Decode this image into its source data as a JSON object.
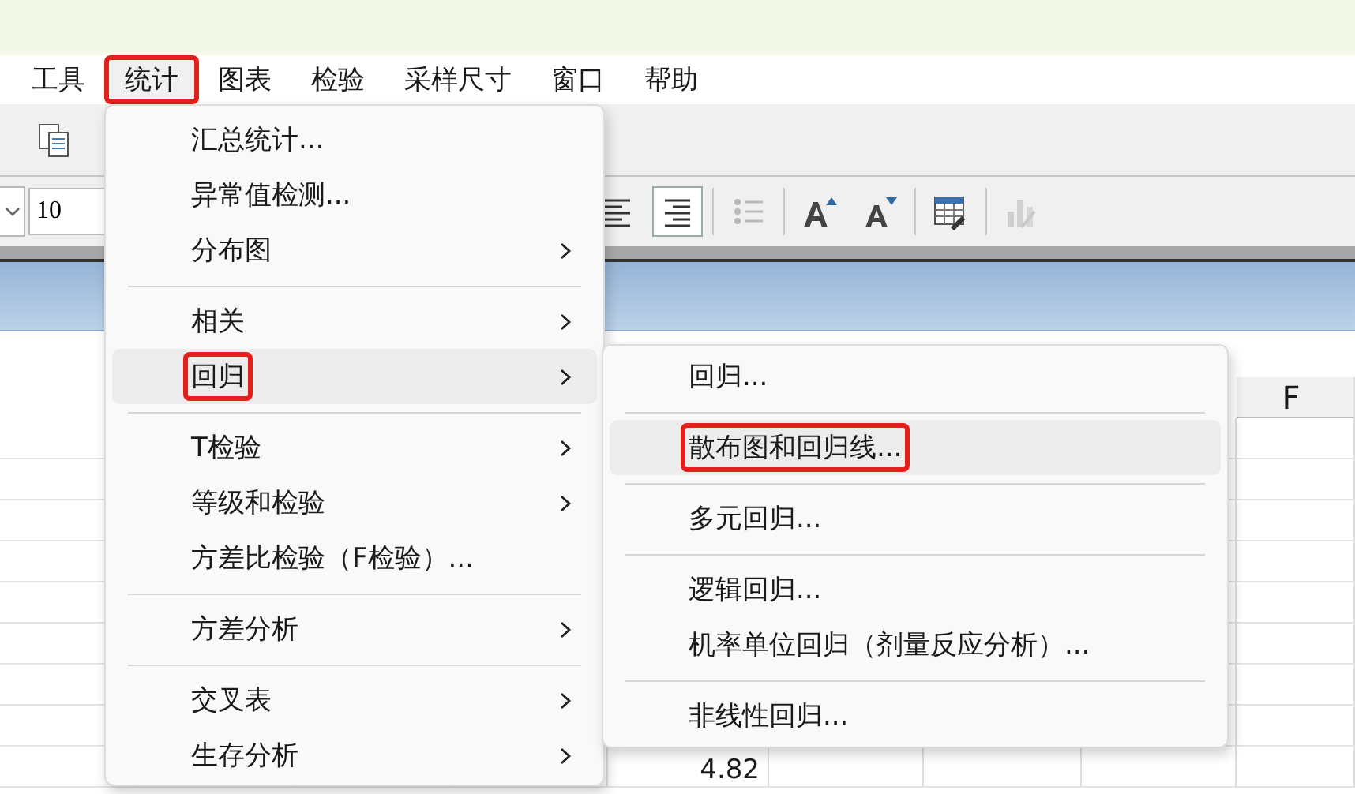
{
  "menubar": [
    {
      "label": "工具",
      "selected": false,
      "annotated": false
    },
    {
      "label": "统计",
      "selected": true,
      "annotated": true
    },
    {
      "label": "图表",
      "selected": false,
      "annotated": false
    },
    {
      "label": "检验",
      "selected": false,
      "annotated": false
    },
    {
      "label": "采样尺寸",
      "selected": false,
      "annotated": false
    },
    {
      "label": "窗口",
      "selected": false,
      "annotated": false
    },
    {
      "label": "帮助",
      "selected": false,
      "annotated": false
    }
  ],
  "toolbar": {
    "buttons": [
      {
        "kind": "copy",
        "disabled": false
      }
    ]
  },
  "format_bar": {
    "font_size": "10",
    "buttons": [
      {
        "kind": "align-left",
        "pressed": false,
        "disabled": false
      },
      {
        "kind": "align-right",
        "pressed": true,
        "disabled": false
      },
      {
        "kind": "bullet-list",
        "pressed": false,
        "disabled": true
      },
      {
        "kind": "font-grow",
        "pressed": false,
        "disabled": false
      },
      {
        "kind": "font-shrink",
        "pressed": false,
        "disabled": false
      },
      {
        "kind": "table-settings",
        "pressed": false,
        "disabled": false
      },
      {
        "kind": "chart-edit",
        "pressed": false,
        "disabled": true
      }
    ]
  },
  "sheet": {
    "column_header": "F",
    "cell": "4.82"
  },
  "menu": {
    "items": [
      {
        "kind": "item",
        "label": "汇总统计...",
        "submenu": false,
        "selected": false,
        "annotated": false
      },
      {
        "kind": "item",
        "label": "异常值检测...",
        "submenu": false,
        "selected": false,
        "annotated": false
      },
      {
        "kind": "item",
        "label": "分布图",
        "submenu": true,
        "selected": false,
        "annotated": false
      },
      {
        "kind": "separator"
      },
      {
        "kind": "item",
        "label": "相关",
        "submenu": true,
        "selected": false,
        "annotated": false
      },
      {
        "kind": "item",
        "label": "回归",
        "submenu": true,
        "selected": true,
        "annotated": true
      },
      {
        "kind": "separator"
      },
      {
        "kind": "item",
        "label": "T检验",
        "submenu": true,
        "selected": false,
        "annotated": false
      },
      {
        "kind": "item",
        "label": "等级和检验",
        "submenu": true,
        "selected": false,
        "annotated": false
      },
      {
        "kind": "item",
        "label": "方差比检验（F检验）...",
        "submenu": false,
        "selected": false,
        "annotated": false
      },
      {
        "kind": "separator"
      },
      {
        "kind": "item",
        "label": "方差分析",
        "submenu": true,
        "selected": false,
        "annotated": false
      },
      {
        "kind": "separator"
      },
      {
        "kind": "item",
        "label": "交叉表",
        "submenu": true,
        "selected": false,
        "annotated": false
      },
      {
        "kind": "item",
        "label": "生存分析",
        "submenu": true,
        "selected": false,
        "annotated": false
      }
    ]
  },
  "submenu": {
    "items": [
      {
        "kind": "item",
        "label": "回归...",
        "submenu": false,
        "selected": false,
        "annotated": false
      },
      {
        "kind": "separator"
      },
      {
        "kind": "item",
        "label": "散布图和回归线...",
        "submenu": false,
        "selected": true,
        "annotated": true
      },
      {
        "kind": "separator"
      },
      {
        "kind": "item",
        "label": "多元回归...",
        "submenu": false,
        "selected": false,
        "annotated": false
      },
      {
        "kind": "separator"
      },
      {
        "kind": "item",
        "label": "逻辑回归...",
        "submenu": false,
        "selected": false,
        "annotated": false
      },
      {
        "kind": "item",
        "label": "机率单位回归（剂量反应分析）...",
        "submenu": false,
        "selected": false,
        "annotated": false
      },
      {
        "kind": "separator"
      },
      {
        "kind": "item",
        "label": "非线性回归...",
        "submenu": false,
        "selected": false,
        "annotated": false
      }
    ]
  }
}
